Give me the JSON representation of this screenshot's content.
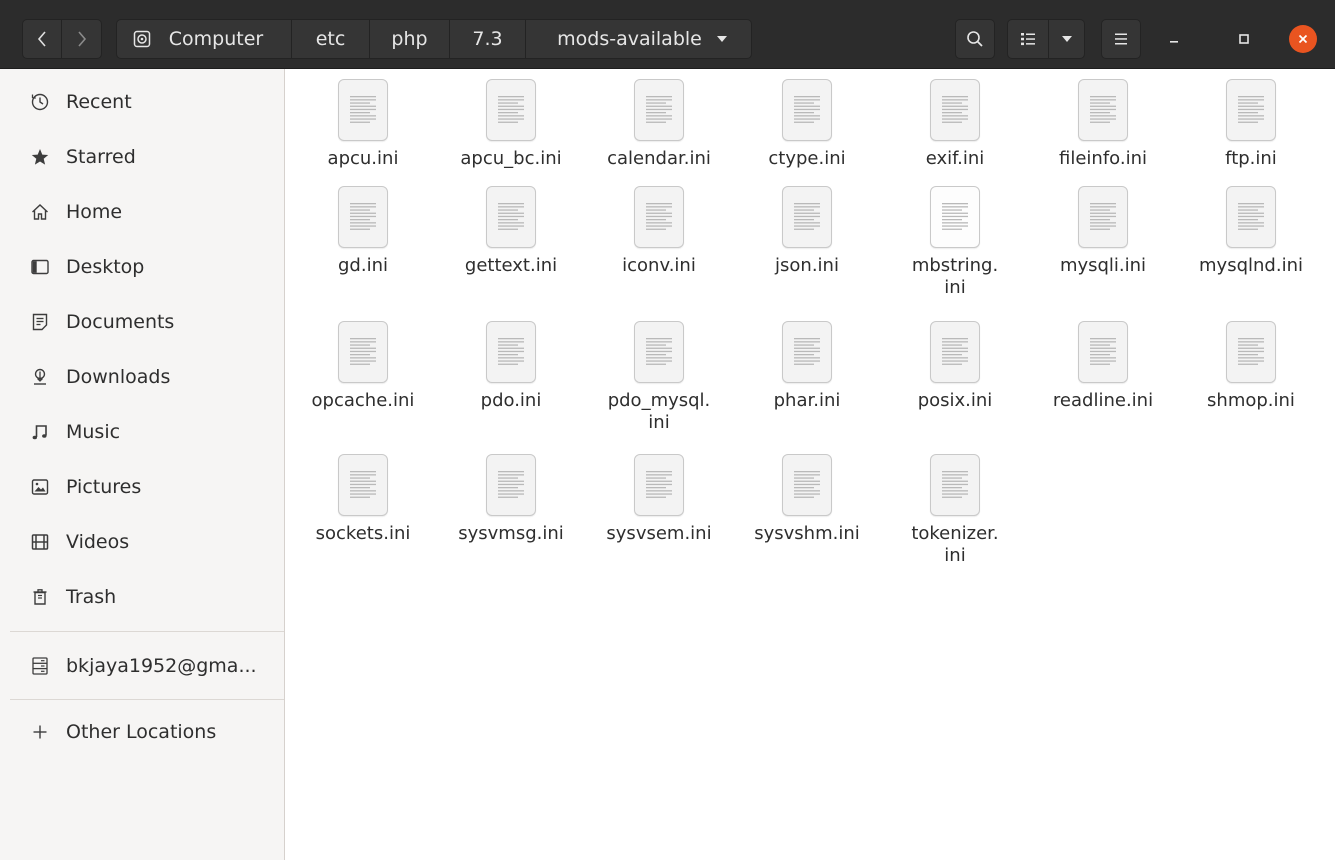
{
  "window": {
    "path": [
      "Computer",
      "etc",
      "php",
      "7.3",
      "mods-available"
    ]
  },
  "sidebar": {
    "items": [
      {
        "label": "Recent",
        "icon": "clock-icon"
      },
      {
        "label": "Starred",
        "icon": "star-icon"
      },
      {
        "label": "Home",
        "icon": "home-icon"
      },
      {
        "label": "Desktop",
        "icon": "desktop-icon"
      },
      {
        "label": "Documents",
        "icon": "documents-icon"
      },
      {
        "label": "Downloads",
        "icon": "download-icon"
      },
      {
        "label": "Music",
        "icon": "music-icon"
      },
      {
        "label": "Pictures",
        "icon": "picture-icon"
      },
      {
        "label": "Videos",
        "icon": "video-icon"
      },
      {
        "label": "Trash",
        "icon": "trash-icon"
      }
    ],
    "network_item": {
      "label": "bkjaya1952@gma...",
      "icon": "network-drive-icon"
    },
    "other_locations": {
      "label": "Other Locations",
      "icon": "plus-icon"
    }
  },
  "files": [
    "apcu.ini",
    "apcu_bc.ini",
    "calendar.ini",
    "ctype.ini",
    "exif.ini",
    "fileinfo.ini",
    "ftp.ini",
    "gd.ini",
    "gettext.ini",
    "iconv.ini",
    "json.ini",
    "mbstring.\nini",
    "mysqli.ini",
    "mysqlnd.ini",
    "opcache.ini",
    "pdo.ini",
    "pdo_mysql.\nini",
    "phar.ini",
    "posix.ini",
    "readline.ini",
    "shmop.ini",
    "sockets.ini",
    "sysvmsg.ini",
    "sysvsem.ini",
    "sysvshm.ini",
    "tokenizer.\nini"
  ],
  "colors": {
    "header_bg": "#2c2c2c",
    "close_button": "#e95420",
    "sidebar_bg": "#f6f5f4"
  }
}
